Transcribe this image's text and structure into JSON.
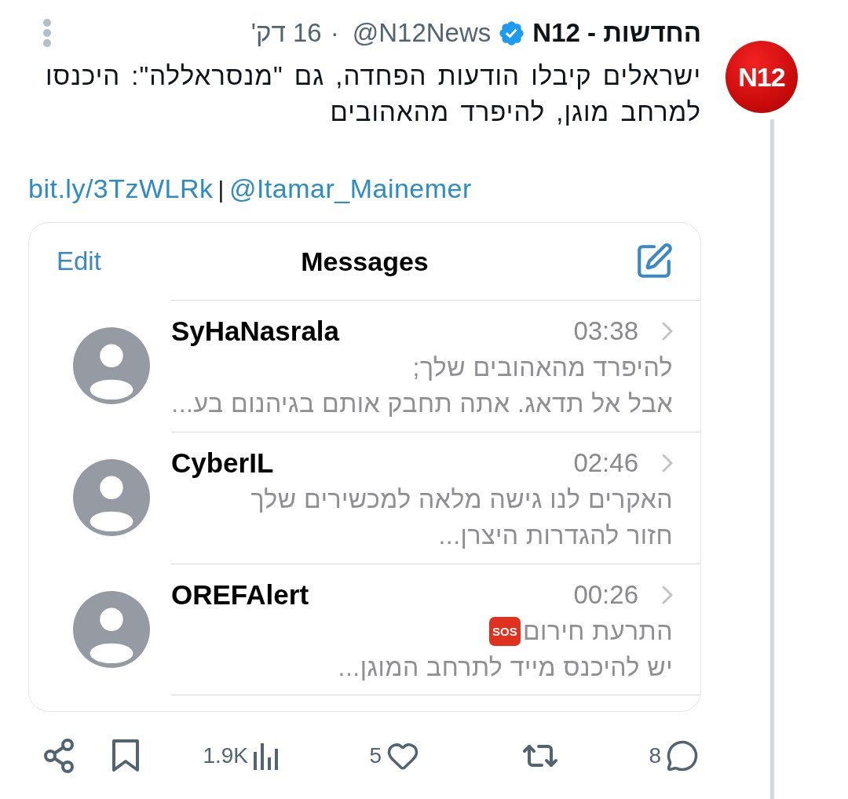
{
  "post": {
    "author": {
      "name": "החדשות - N12",
      "verified": true,
      "handle": "@N12News",
      "separator": "·",
      "time": "16 דק'"
    },
    "avatar": {
      "label": "N12"
    },
    "text": "ישראלים קיבלו הודעות הפחדה, גם \"מנסראללה\": היכנסו למרחב מוגן, להיפרד מהאהובים",
    "link_line": {
      "url": "bit.ly/3TzWLRk",
      "separator": "|",
      "mention": "@Itamar_Mainemer"
    },
    "media": {
      "header": {
        "edit": "Edit",
        "title": "Messages"
      },
      "threads": [
        {
          "name": "SyHaNasrala",
          "time": "03:38",
          "preview": [
            {
              "text": "להיפרד מהאהובים שלך;"
            },
            {
              "text": "אבל אל תדאג. אתה תחבק אותם בגיהנום בע..."
            }
          ]
        },
        {
          "name": "CyberIL",
          "time": "02:46",
          "preview": [
            {
              "text": "האקרים לנו גישה מלאה למכשירים שלך"
            },
            {
              "text": "חזור להגדרות היצרן..."
            }
          ]
        },
        {
          "name": "OREFAlert",
          "time": "00:26",
          "preview": [
            {
              "text": "התרעת חירום",
              "emoji": "SOS"
            },
            {
              "text": "יש להיכנס מייד לתרחב המוגן..."
            }
          ]
        }
      ]
    },
    "actions": [
      {
        "kind": "reply",
        "count": "8"
      },
      {
        "kind": "repost"
      },
      {
        "kind": "like",
        "count": "5"
      },
      {
        "kind": "views",
        "count": "1.9K"
      },
      {
        "kind": "bookmark"
      },
      {
        "kind": "share"
      }
    ]
  }
}
